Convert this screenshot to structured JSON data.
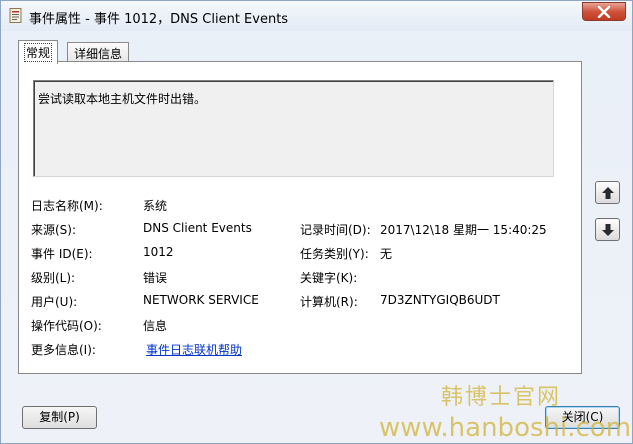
{
  "window": {
    "title": "事件属性 - 事件 1012，DNS Client Events"
  },
  "tabs": [
    {
      "label": "常规",
      "active": true
    },
    {
      "label": "详细信息",
      "active": false
    }
  ],
  "description": "尝试读取本地主机文件时出错。",
  "fields": {
    "log_name_label": "日志名称(M):",
    "log_name_value": "系统",
    "source_label": "来源(S):",
    "source_value": "DNS Client Events",
    "logged_label": "记录时间(D):",
    "logged_value": "2017\\12\\18 星期一 15:40:25",
    "event_id_label": "事件 ID(E):",
    "event_id_value": "1012",
    "task_label": "任务类别(Y):",
    "task_value": "无",
    "level_label": "级别(L):",
    "level_value": "错误",
    "keywords_label": "关键字(K):",
    "keywords_value": "",
    "user_label": "用户(U):",
    "user_value": "NETWORK SERVICE",
    "computer_label": "计算机(R):",
    "computer_value": "7D3ZNTYGIQB6UDT",
    "opcode_label": "操作代码(O):",
    "opcode_value": "信息",
    "more_info_label": "更多信息(I):",
    "more_info_link": "事件日志联机帮助"
  },
  "buttons": {
    "copy": "复制(P)",
    "close": "关闭(C)"
  },
  "watermark": {
    "text_cn": "韩博士官网",
    "text_url": "www.hanboshi.com"
  },
  "icons": {
    "app": "event-properties-icon",
    "close": "close-icon",
    "up": "arrow-up-icon",
    "down": "arrow-down-icon"
  }
}
